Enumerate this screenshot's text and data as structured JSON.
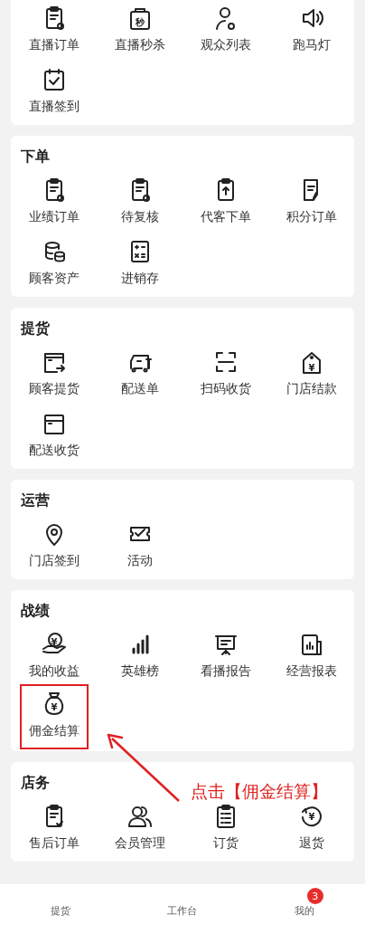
{
  "sections": [
    {
      "items": [
        {
          "label": "直播订单"
        },
        {
          "label": "直播秒杀",
          "icon_text": "秒"
        },
        {
          "label": "观众列表"
        },
        {
          "label": "跑马灯"
        },
        {
          "label": "直播签到"
        }
      ]
    },
    {
      "title": "下单",
      "items": [
        {
          "label": "业绩订单"
        },
        {
          "label": "待复核"
        },
        {
          "label": "代客下单"
        },
        {
          "label": "积分订单"
        },
        {
          "label": "顾客资产"
        },
        {
          "label": "进销存"
        }
      ]
    },
    {
      "title": "提货",
      "items": [
        {
          "label": "顾客提货"
        },
        {
          "label": "配送单"
        },
        {
          "label": "扫码收货"
        },
        {
          "label": "门店结款",
          "icon_text": "¥"
        },
        {
          "label": "配送收货"
        }
      ]
    },
    {
      "title": "运营",
      "items": [
        {
          "label": "门店签到"
        },
        {
          "label": "活动"
        }
      ]
    },
    {
      "title": "战绩",
      "items": [
        {
          "label": "我的收益",
          "icon_text": "¥"
        },
        {
          "label": "英雄榜"
        },
        {
          "label": "看播报告"
        },
        {
          "label": "经营报表"
        },
        {
          "label": "佣金结算",
          "icon_text": "¥",
          "highlighted": true
        }
      ]
    },
    {
      "title": "店务",
      "items": [
        {
          "label": "售后订单"
        },
        {
          "label": "会员管理"
        },
        {
          "label": "订货"
        },
        {
          "label": "退货",
          "icon_text": "¥"
        }
      ]
    }
  ],
  "annotation": {
    "text": "点击【佣金结算】"
  },
  "tab_bar": [
    {
      "label": "提货"
    },
    {
      "label": "工作台"
    },
    {
      "label": "我的",
      "badge": "3"
    }
  ]
}
